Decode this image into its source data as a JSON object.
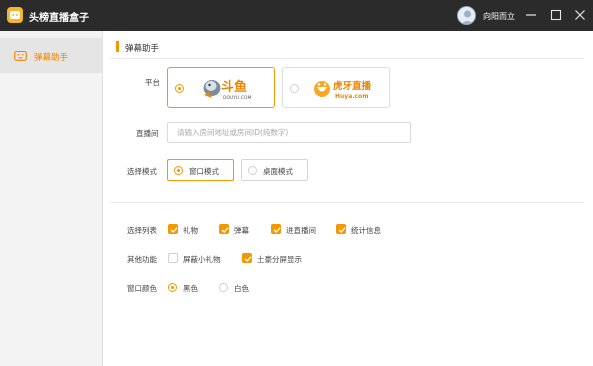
{
  "window": {
    "app_title": "头榜直播盒子",
    "user_name": "向阳而立",
    "colors": {
      "titlebar": "#2b2b2b",
      "accent": "#f39800",
      "sidebar": "#f3f3f3"
    }
  },
  "sidebar": {
    "items": [
      {
        "label": "弹幕助手",
        "icon": "gift-icon",
        "selected": true
      }
    ]
  },
  "main": {
    "section_title": "弹幕助手",
    "platform": {
      "label": "平台",
      "options": [
        {
          "name": "douyu",
          "logo_text": "斗鱼",
          "logo_sub": "DOUYU.COM",
          "selected": true
        },
        {
          "name": "huya",
          "logo_text": "虎牙直播",
          "logo_sub": "Huya.com",
          "selected": false
        }
      ]
    },
    "room": {
      "label": "直播间",
      "value": "",
      "placeholder": "请输入房间地址或房间ID(纯数字)"
    },
    "mode": {
      "label": "选择模式",
      "options": [
        {
          "label": "窗口模式",
          "selected": true
        },
        {
          "label": "桌面模式",
          "selected": false
        }
      ]
    },
    "list_select": {
      "label": "选择列表",
      "items": [
        {
          "label": "礼物",
          "checked": true
        },
        {
          "label": "弹幕",
          "checked": true
        },
        {
          "label": "进直播间",
          "checked": true
        },
        {
          "label": "统计信息",
          "checked": true
        }
      ]
    },
    "other": {
      "label": "其他功能",
      "items": [
        {
          "label": "屏蔽小礼物",
          "checked": false
        },
        {
          "label": "土豪分屏显示",
          "checked": true
        }
      ]
    },
    "color": {
      "label": "窗口颜色",
      "options": [
        {
          "label": "黑色",
          "selected": true
        },
        {
          "label": "白色",
          "selected": false
        }
      ]
    }
  }
}
